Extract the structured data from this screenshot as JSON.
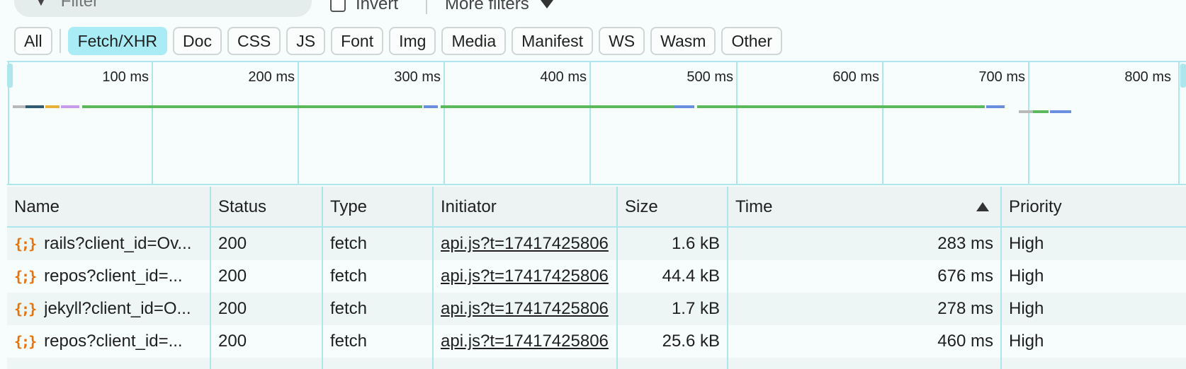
{
  "filter": {
    "placeholder": "Filter",
    "invert_label": "Invert",
    "more_filters_label": "More filters"
  },
  "chips": [
    {
      "label": "All",
      "active": false
    },
    {
      "label": "Fetch/XHR",
      "active": true
    },
    {
      "label": "Doc",
      "active": false
    },
    {
      "label": "CSS",
      "active": false
    },
    {
      "label": "JS",
      "active": false
    },
    {
      "label": "Font",
      "active": false
    },
    {
      "label": "Img",
      "active": false
    },
    {
      "label": "Media",
      "active": false
    },
    {
      "label": "Manifest",
      "active": false
    },
    {
      "label": "WS",
      "active": false
    },
    {
      "label": "Wasm",
      "active": false
    },
    {
      "label": "Other",
      "active": false
    }
  ],
  "overview": {
    "ticks": [
      "100 ms",
      "200 ms",
      "300 ms",
      "400 ms",
      "500 ms",
      "600 ms",
      "700 ms",
      "800 ms"
    ],
    "colors": {
      "grid": "#aee6ee",
      "green": "#5cb85c",
      "blue": "#6b8fe0",
      "dark": "#2e5b72",
      "orange": "#e8b13a",
      "purple": "#c89be8",
      "gray": "#b9b9b9"
    }
  },
  "table": {
    "headers": {
      "name": "Name",
      "status": "Status",
      "type": "Type",
      "initiator": "Initiator",
      "size": "Size",
      "time": "Time",
      "priority": "Priority"
    },
    "rows": [
      {
        "name": "rails?client_id=Ov...",
        "status": "200",
        "type": "fetch",
        "initiator": "api.js?t=17417425806",
        "size": "1.6 kB",
        "time": "283 ms",
        "priority": "High"
      },
      {
        "name": "repos?client_id=...",
        "status": "200",
        "type": "fetch",
        "initiator": "api.js?t=17417425806",
        "size": "44.4 kB",
        "time": "676 ms",
        "priority": "High"
      },
      {
        "name": "jekyll?client_id=O...",
        "status": "200",
        "type": "fetch",
        "initiator": "api.js?t=17417425806",
        "size": "1.7 kB",
        "time": "278 ms",
        "priority": "High"
      },
      {
        "name": "repos?client_id=...",
        "status": "200",
        "type": "fetch",
        "initiator": "api.js?t=17417425806",
        "size": "25.6 kB",
        "time": "460 ms",
        "priority": "High"
      }
    ]
  }
}
